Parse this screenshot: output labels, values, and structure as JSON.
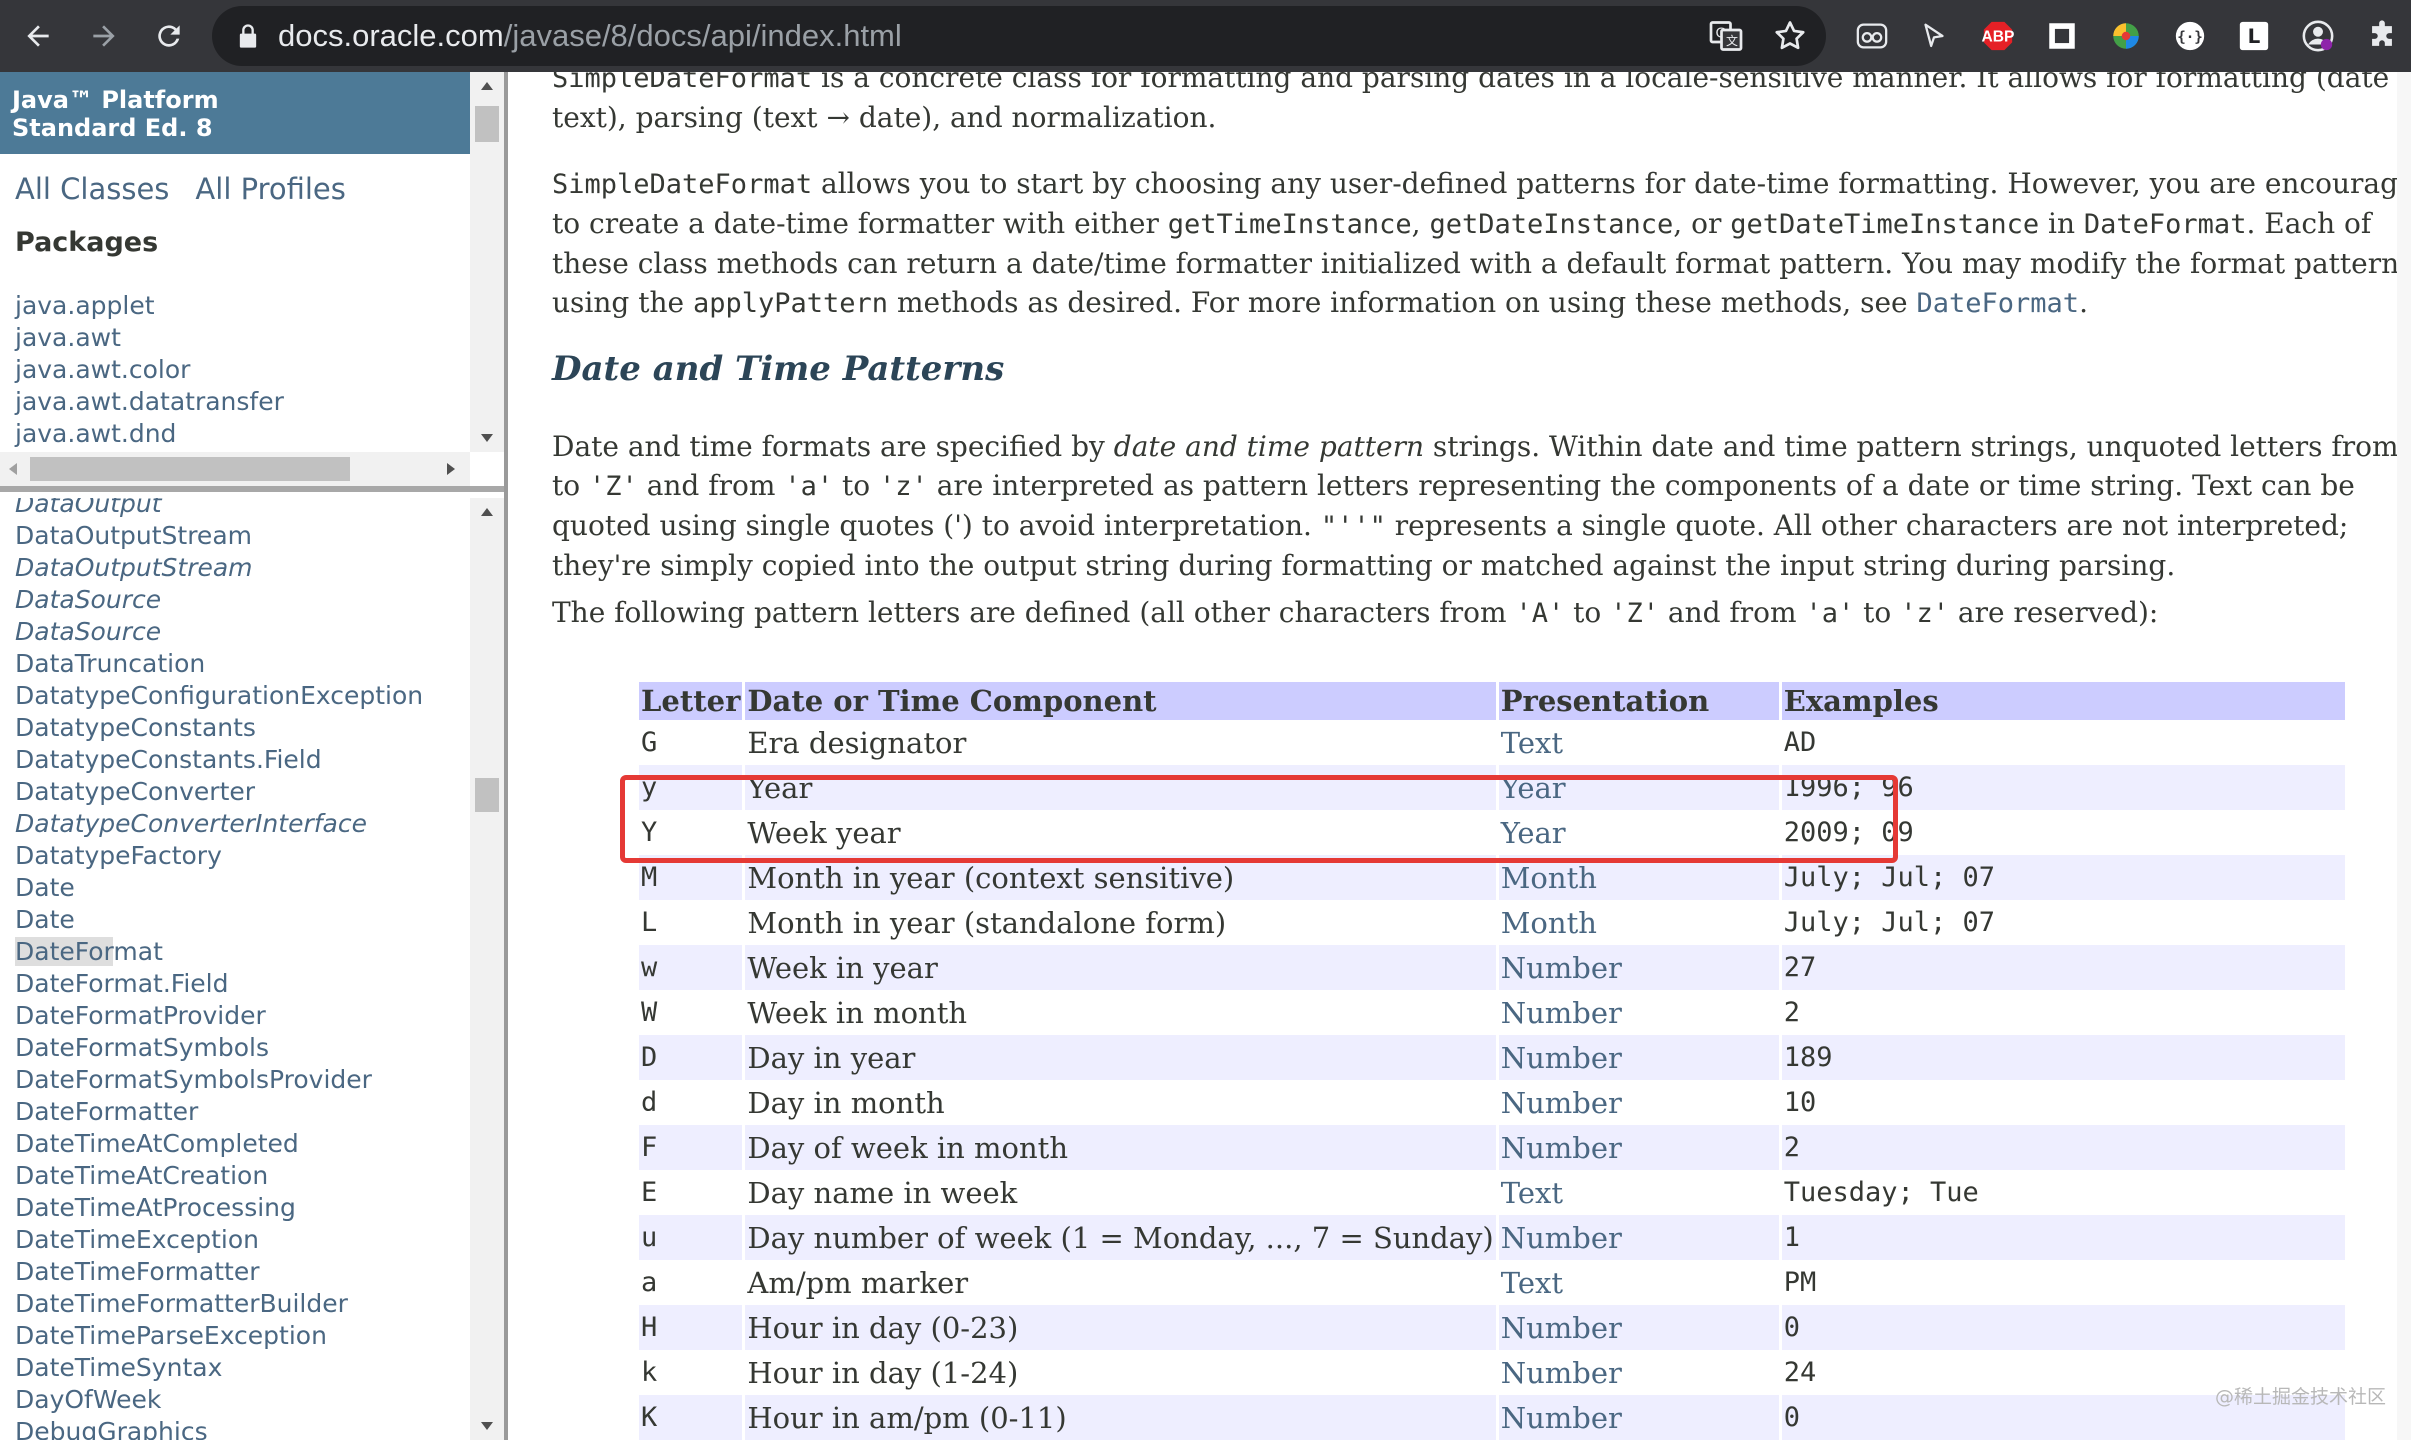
{
  "browser": {
    "url_host": "docs.oracle.com",
    "url_path": "/javase/8/docs/api/index.html",
    "extensions": [
      "translate-icon",
      "bookmark-star-icon",
      "eyes-extension-icon",
      "cursor-extension-icon",
      "adblock-plus-icon",
      "square-extension-icon",
      "colorful-extension-icon",
      "code-extension-icon",
      "l-extension-icon",
      "lock-person-extension-icon",
      "puzzle-extensions-icon"
    ],
    "abp_label": "ABP",
    "l_label": "L"
  },
  "sidebar": {
    "platform_line1": "Java™ Platform",
    "platform_line2": "Standard Ed. 8",
    "all_classes": "All Classes",
    "all_profiles": "All Profiles",
    "packages_heading": "Packages",
    "packages": [
      "java.applet",
      "java.awt",
      "java.awt.color",
      "java.awt.datatransfer",
      "java.awt.dnd"
    ],
    "classes": [
      {
        "name": "DataOutput",
        "italic": true
      },
      {
        "name": "DataOutputStream",
        "italic": false
      },
      {
        "name": "DataOutputStream",
        "italic": true
      },
      {
        "name": "DataSource",
        "italic": true
      },
      {
        "name": "DataSource",
        "italic": true
      },
      {
        "name": "DataTruncation",
        "italic": false
      },
      {
        "name": "DatatypeConfigurationException",
        "italic": false
      },
      {
        "name": "DatatypeConstants",
        "italic": false
      },
      {
        "name": "DatatypeConstants.Field",
        "italic": false
      },
      {
        "name": "DatatypeConverter",
        "italic": false
      },
      {
        "name": "DatatypeConverterInterface",
        "italic": true
      },
      {
        "name": "DatatypeFactory",
        "italic": false
      },
      {
        "name": "Date",
        "italic": false
      },
      {
        "name": "Date",
        "italic": false
      },
      {
        "name": "DateFormat",
        "italic": false,
        "highlight": "DateFor",
        "rest": "mat"
      },
      {
        "name": "DateFormat.Field",
        "italic": false
      },
      {
        "name": "DateFormatProvider",
        "italic": false
      },
      {
        "name": "DateFormatSymbols",
        "italic": false
      },
      {
        "name": "DateFormatSymbolsProvider",
        "italic": false
      },
      {
        "name": "DateFormatter",
        "italic": false
      },
      {
        "name": "DateTimeAtCompleted",
        "italic": false
      },
      {
        "name": "DateTimeAtCreation",
        "italic": false
      },
      {
        "name": "DateTimeAtProcessing",
        "italic": false
      },
      {
        "name": "DateTimeException",
        "italic": false
      },
      {
        "name": "DateTimeFormatter",
        "italic": false
      },
      {
        "name": "DateTimeFormatterBuilder",
        "italic": false
      },
      {
        "name": "DateTimeParseException",
        "italic": false
      },
      {
        "name": "DateTimeSyntax",
        "italic": false
      },
      {
        "name": "DayOfWeek",
        "italic": false
      },
      {
        "name": "DebugGraphics",
        "italic": false
      }
    ]
  },
  "content": {
    "intro_line1_code": "SimpleDateFormat",
    "intro_line1_text": " is a concrete class for formatting and parsing dates in a locale-sensitive manner. It allows for formatting (date",
    "intro_line2": "text), parsing (text → date), and normalization.",
    "p2_code1": "SimpleDateFormat",
    "p2_text1": " allows you to start by choosing any user-defined patterns for date-time formatting. However, you are encourag",
    "p2_text2": "to create a date-time formatter with either ",
    "p2_code2": "getTimeInstance",
    "p2_sep1": ", ",
    "p2_code3": "getDateInstance",
    "p2_sep2": ", or ",
    "p2_code4": "getDateTimeInstance",
    "p2_text3": " in ",
    "p2_code5": "DateFormat",
    "p2_text4": ". Each of",
    "p2_line3": "these class methods can return a date/time formatter initialized with a default format pattern. You may modify the format pattern",
    "p2_text5": "using the ",
    "p2_code6": "applyPattern",
    "p2_text6": " methods as desired. For more information on using these methods, see ",
    "p2_link": "DateFormat",
    "p2_end": ".",
    "section_title": "Date and Time Patterns",
    "p3_a": "Date and time formats are specified by ",
    "p3_em": "date and time pattern",
    "p3_b": " strings. Within date and time pattern strings, unquoted letters from",
    "p3_l2_a": "to ",
    "p3_l2_c1": "'Z'",
    "p3_l2_b": " and from ",
    "p3_l2_c2": "'a'",
    "p3_l2_c": " to ",
    "p3_l2_c3": "'z'",
    "p3_l2_d": " are interpreted as pattern letters representing the components of a date or time string. Text can be",
    "p3_l3_a": "quoted using single quotes (') to avoid interpretation. ",
    "p3_l3_code": "\"''\"",
    "p3_l3_b": " represents a single quote. All other characters are not interpreted;",
    "p3_l4": "they're simply copied into the output string during formatting or matched against the input string during parsing.",
    "p4_a": "The following pattern letters are defined (all other characters from ",
    "p4_c1": "'A'",
    "p4_b": " to ",
    "p4_c2": "'Z'",
    "p4_c": " and from ",
    "p4_c3": "'a'",
    "p4_d": " to ",
    "p4_c4": "'z'",
    "p4_e": " are reserved):",
    "table_headers": [
      "Letter",
      "Date or Time Component",
      "Presentation",
      "Examples"
    ],
    "table_rows": [
      [
        "G",
        "Era designator",
        "Text",
        "AD"
      ],
      [
        "y",
        "Year",
        "Year",
        "1996; 96"
      ],
      [
        "Y",
        "Week year",
        "Year",
        "2009; 09"
      ],
      [
        "M",
        "Month in year (context sensitive)",
        "Month",
        "July; Jul; 07"
      ],
      [
        "L",
        "Month in year (standalone form)",
        "Month",
        "July; Jul; 07"
      ],
      [
        "w",
        "Week in year",
        "Number",
        "27"
      ],
      [
        "W",
        "Week in month",
        "Number",
        "2"
      ],
      [
        "D",
        "Day in year",
        "Number",
        "189"
      ],
      [
        "d",
        "Day in month",
        "Number",
        "10"
      ],
      [
        "F",
        "Day of week in month",
        "Number",
        "2"
      ],
      [
        "E",
        "Day name in week",
        "Text",
        "Tuesday; Tue"
      ],
      [
        "u",
        "Day number of week (1 = Monday, ..., 7 = Sunday)",
        "Number",
        "1"
      ],
      [
        "a",
        "Am/pm marker",
        "Text",
        "PM"
      ],
      [
        "H",
        "Hour in day (0-23)",
        "Number",
        "0"
      ],
      [
        "k",
        "Hour in day (1-24)",
        "Number",
        "24"
      ],
      [
        "K",
        "Hour in am/pm (0-11)",
        "Number",
        "0"
      ]
    ],
    "watermark": "@稀土掘金技术社区"
  },
  "colors": {
    "toolbar": "#35363a",
    "omnibox": "#202124",
    "platform_banner": "#4d7a97",
    "link": "#4a6782",
    "table_header": "#ccccff",
    "table_alt_row": "#eeeeff",
    "annotation_box": "#e53935"
  }
}
